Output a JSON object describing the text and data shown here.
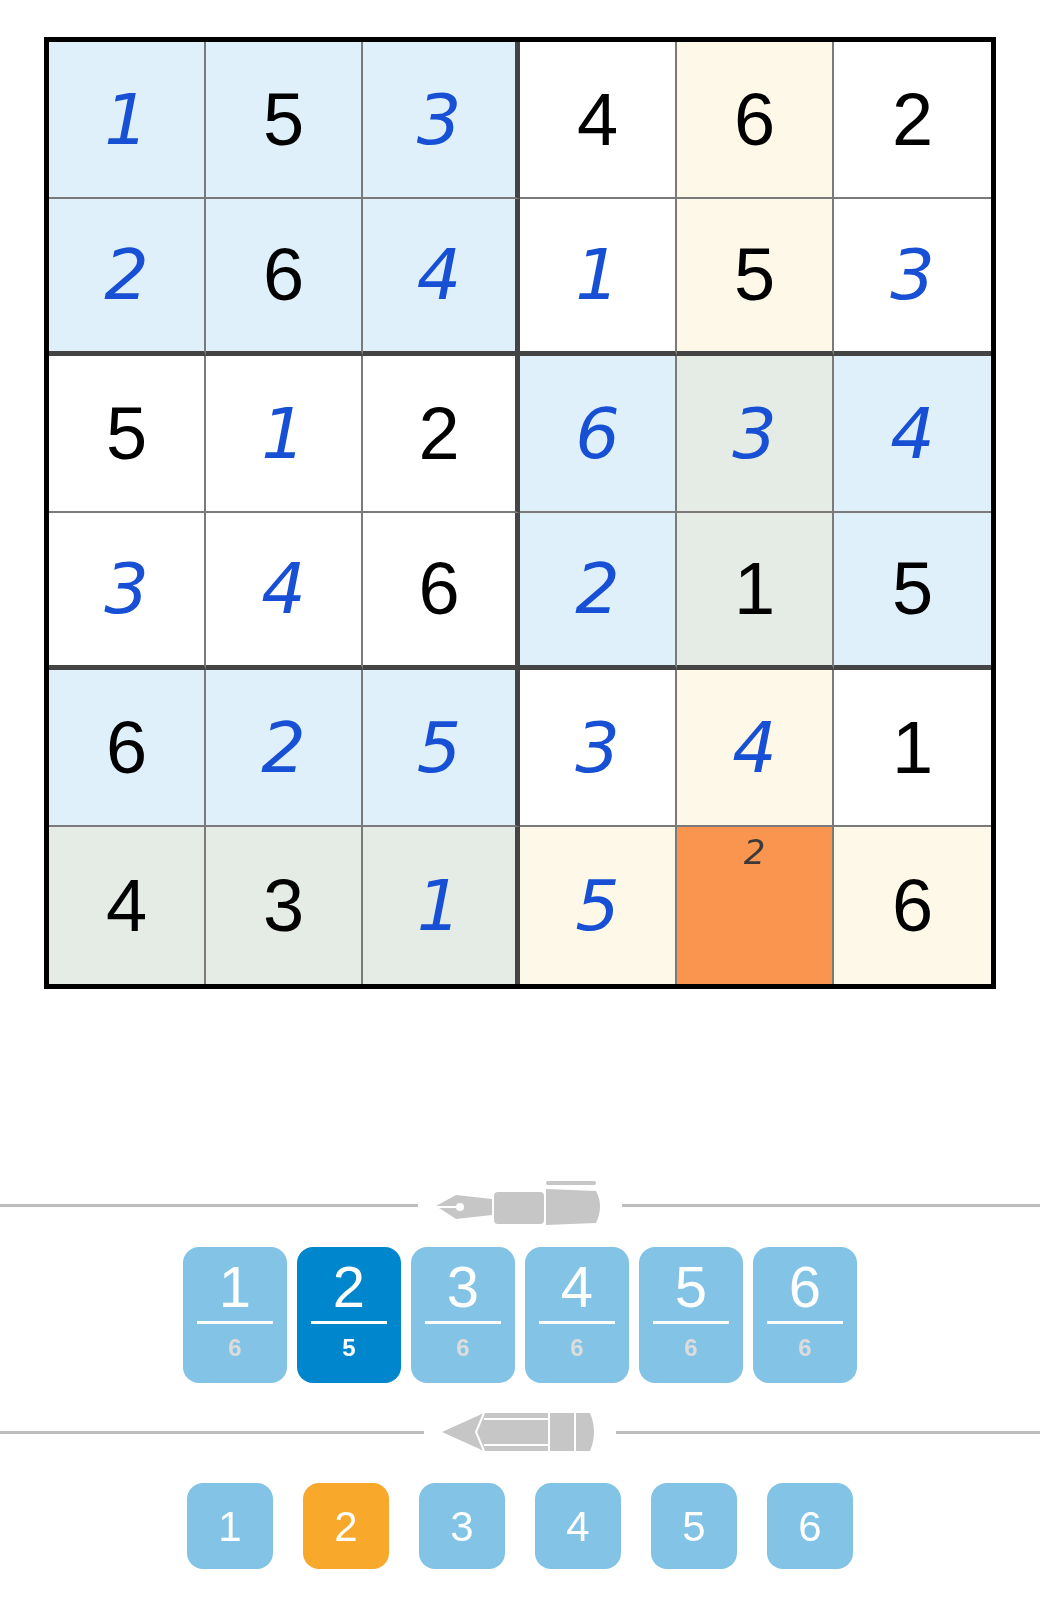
{
  "board": {
    "rows": [
      [
        {
          "value": "1",
          "kind": "entered",
          "color": "#dff0fb",
          "selected": false
        },
        {
          "value": "5",
          "kind": "given",
          "color": "#dff0fb",
          "selected": false
        },
        {
          "value": "3",
          "kind": "entered",
          "color": "#dff0fb",
          "selected": false
        },
        {
          "value": "4",
          "kind": "given",
          "color": "#ffffff",
          "selected": false
        },
        {
          "value": "6",
          "kind": "given",
          "color": "#fef8e8",
          "selected": false
        },
        {
          "value": "2",
          "kind": "given",
          "color": "#ffffff",
          "selected": false
        }
      ],
      [
        {
          "value": "2",
          "kind": "entered",
          "color": "#dff0fb",
          "selected": false
        },
        {
          "value": "6",
          "kind": "given",
          "color": "#dff0fb",
          "selected": false
        },
        {
          "value": "4",
          "kind": "entered",
          "color": "#dff0fb",
          "selected": false
        },
        {
          "value": "1",
          "kind": "entered",
          "color": "#ffffff",
          "selected": false
        },
        {
          "value": "5",
          "kind": "given",
          "color": "#fef8e8",
          "selected": false
        },
        {
          "value": "3",
          "kind": "entered",
          "color": "#ffffff",
          "selected": false
        }
      ],
      [
        {
          "value": "5",
          "kind": "given",
          "color": "#ffffff",
          "selected": false
        },
        {
          "value": "1",
          "kind": "entered",
          "color": "#ffffff",
          "selected": false
        },
        {
          "value": "2",
          "kind": "given",
          "color": "#ffffff",
          "selected": false
        },
        {
          "value": "6",
          "kind": "entered",
          "color": "#dff0fb",
          "selected": false
        },
        {
          "value": "3",
          "kind": "entered",
          "color": "#e5ebe5",
          "selected": false
        },
        {
          "value": "4",
          "kind": "entered",
          "color": "#dff0fb",
          "selected": false
        }
      ],
      [
        {
          "value": "3",
          "kind": "entered",
          "color": "#ffffff",
          "selected": false
        },
        {
          "value": "4",
          "kind": "entered",
          "color": "#ffffff",
          "selected": false
        },
        {
          "value": "6",
          "kind": "given",
          "color": "#ffffff",
          "selected": false
        },
        {
          "value": "2",
          "kind": "entered",
          "color": "#dff0fb",
          "selected": false
        },
        {
          "value": "1",
          "kind": "given",
          "color": "#e5ebe5",
          "selected": false
        },
        {
          "value": "5",
          "kind": "given",
          "color": "#dff0fb",
          "selected": false
        }
      ],
      [
        {
          "value": "6",
          "kind": "given",
          "color": "#dff0fb",
          "selected": false
        },
        {
          "value": "2",
          "kind": "entered",
          "color": "#dff0fb",
          "selected": false
        },
        {
          "value": "5",
          "kind": "entered",
          "color": "#dff0fb",
          "selected": false
        },
        {
          "value": "3",
          "kind": "entered",
          "color": "#ffffff",
          "selected": false
        },
        {
          "value": "4",
          "kind": "entered",
          "color": "#fef8e8",
          "selected": false
        },
        {
          "value": "1",
          "kind": "given",
          "color": "#ffffff",
          "selected": false
        }
      ],
      [
        {
          "value": "4",
          "kind": "given",
          "color": "#e5ebe5",
          "selected": false
        },
        {
          "value": "3",
          "kind": "given",
          "color": "#e5ebe5",
          "selected": false
        },
        {
          "value": "1",
          "kind": "entered",
          "color": "#e5ebe5",
          "selected": false
        },
        {
          "value": "5",
          "kind": "entered",
          "color": "#fef8e8",
          "selected": false
        },
        {
          "notes": [
            "2"
          ],
          "kind": "empty",
          "selected": true
        },
        {
          "value": "6",
          "kind": "given",
          "color": "#fef8e8",
          "selected": false
        }
      ]
    ]
  },
  "pen_digits": [
    {
      "digit": "1",
      "count": "6",
      "selected": false
    },
    {
      "digit": "2",
      "count": "5",
      "selected": true
    },
    {
      "digit": "3",
      "count": "6",
      "selected": false
    },
    {
      "digit": "4",
      "count": "6",
      "selected": false
    },
    {
      "digit": "5",
      "count": "6",
      "selected": false
    },
    {
      "digit": "6",
      "count": "6",
      "selected": false
    }
  ],
  "pencil_digits": [
    {
      "digit": "1",
      "selected": false
    },
    {
      "digit": "2",
      "selected": true
    },
    {
      "digit": "3",
      "selected": false
    },
    {
      "digit": "4",
      "selected": false
    },
    {
      "digit": "5",
      "selected": false
    },
    {
      "digit": "6",
      "selected": false
    }
  ]
}
